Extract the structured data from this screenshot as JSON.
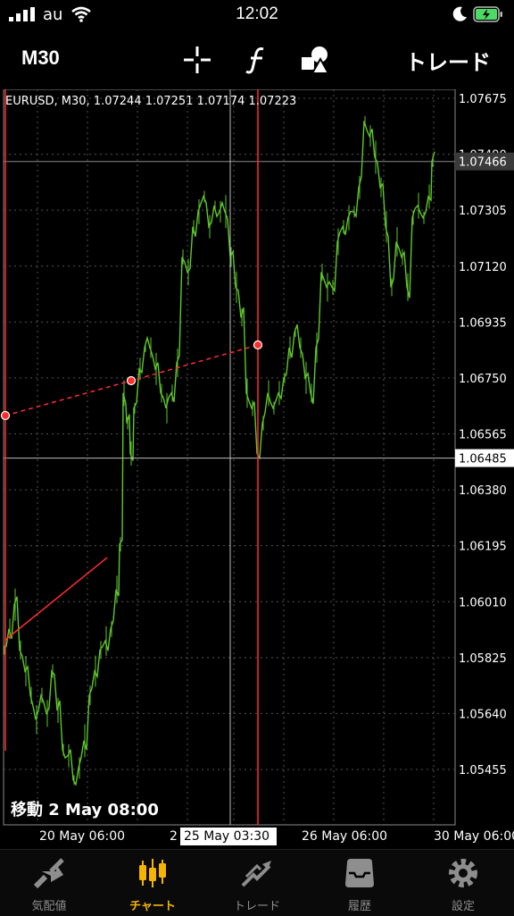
{
  "status_bar": {
    "carrier": "au",
    "time": "12:02"
  },
  "toolbar": {
    "timeframe": "M30",
    "trade_label": "トレード",
    "icons": [
      "crosshair-icon",
      "function-icon",
      "objects-icon"
    ]
  },
  "chart": {
    "header": "EURUSD, M30, 1.07244 1.07251 1.07174 1.07223",
    "price_labels": [
      "1.07675",
      "1.07490",
      "1.07305",
      "1.07120",
      "1.06935",
      "1.06750",
      "1.06565",
      "1.06380",
      "1.06195",
      "1.06010",
      "1.05825",
      "1.05640",
      "1.05455"
    ],
    "current_price": "1.07466",
    "crosshair_price": "1.06485",
    "time_labels": [
      "20 May 06:00",
      "2",
      "26 May 06:00",
      "30 May 06:00"
    ],
    "crosshair_time": "25 May 03:30",
    "move_label": "移動 2 May 08:00",
    "colors": {
      "candle": "#5fc82a",
      "objects": "#ff2d2d",
      "grid": "#555555"
    }
  },
  "tabs": [
    {
      "label": "気配値",
      "icon": "quotes-icon"
    },
    {
      "label": "チャート",
      "icon": "chart-icon",
      "active": true
    },
    {
      "label": "トレード",
      "icon": "trade-icon"
    },
    {
      "label": "履歴",
      "icon": "history-icon"
    },
    {
      "label": "設定",
      "icon": "settings-icon"
    }
  ]
}
